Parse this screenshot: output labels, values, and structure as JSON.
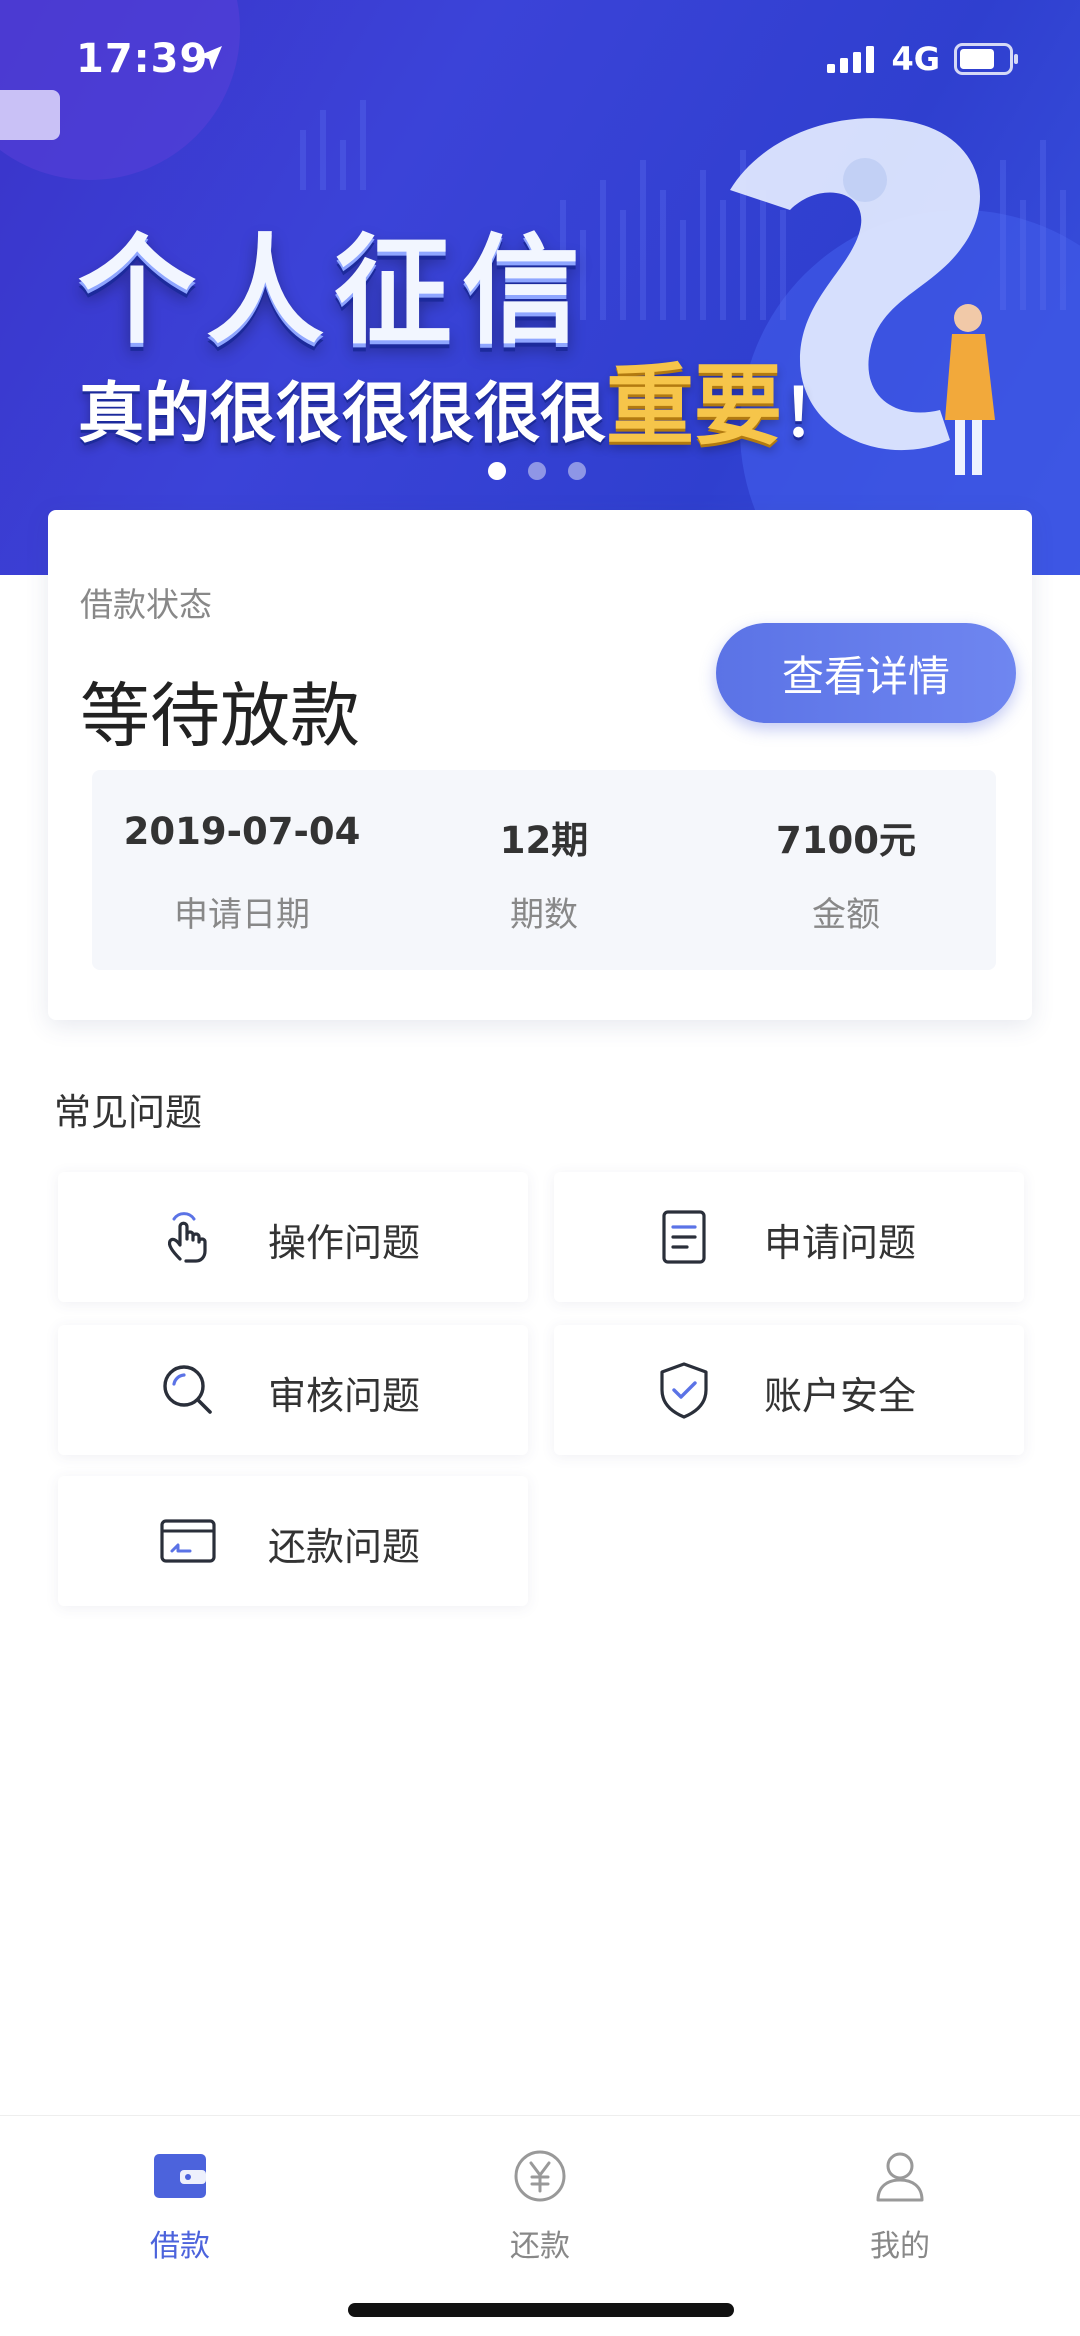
{
  "status_bar": {
    "time": "17:39",
    "network": "4G"
  },
  "banner": {
    "title": "个人征信",
    "subtitle_prefix": "真的很很很很很很",
    "subtitle_emphasis": "重要",
    "subtitle_suffix": "！",
    "dots_total": 3,
    "active_dot": 1
  },
  "loan": {
    "status_label": "借款状态",
    "status_value": "等待放款",
    "detail_button_label": "查看详情",
    "info": [
      {
        "value": "2019-07-04",
        "label": "申请日期"
      },
      {
        "value": "12期",
        "label": "期数"
      },
      {
        "value": "7100元",
        "label": "金额"
      }
    ]
  },
  "faq": {
    "title": "常见问题",
    "items": [
      {
        "label": "操作问题",
        "icon": "tap-hand-icon"
      },
      {
        "label": "申请问题",
        "icon": "document-icon"
      },
      {
        "label": "审核问题",
        "icon": "search-icon"
      },
      {
        "label": "账户安全",
        "icon": "shield-check-icon"
      },
      {
        "label": "还款问题",
        "icon": "card-icon"
      }
    ]
  },
  "tabbar": {
    "tabs": [
      {
        "label": "借款",
        "icon": "wallet-icon",
        "active": true
      },
      {
        "label": "还款",
        "icon": "yen-circle-icon",
        "active": false
      },
      {
        "label": "我的",
        "icon": "person-icon",
        "active": false
      }
    ]
  },
  "colors": {
    "banner_blue": "#3a3fd0",
    "accent": "#5b73e6",
    "tab_active": "#4c63dc",
    "banner_highlight": "#f6c54a"
  }
}
